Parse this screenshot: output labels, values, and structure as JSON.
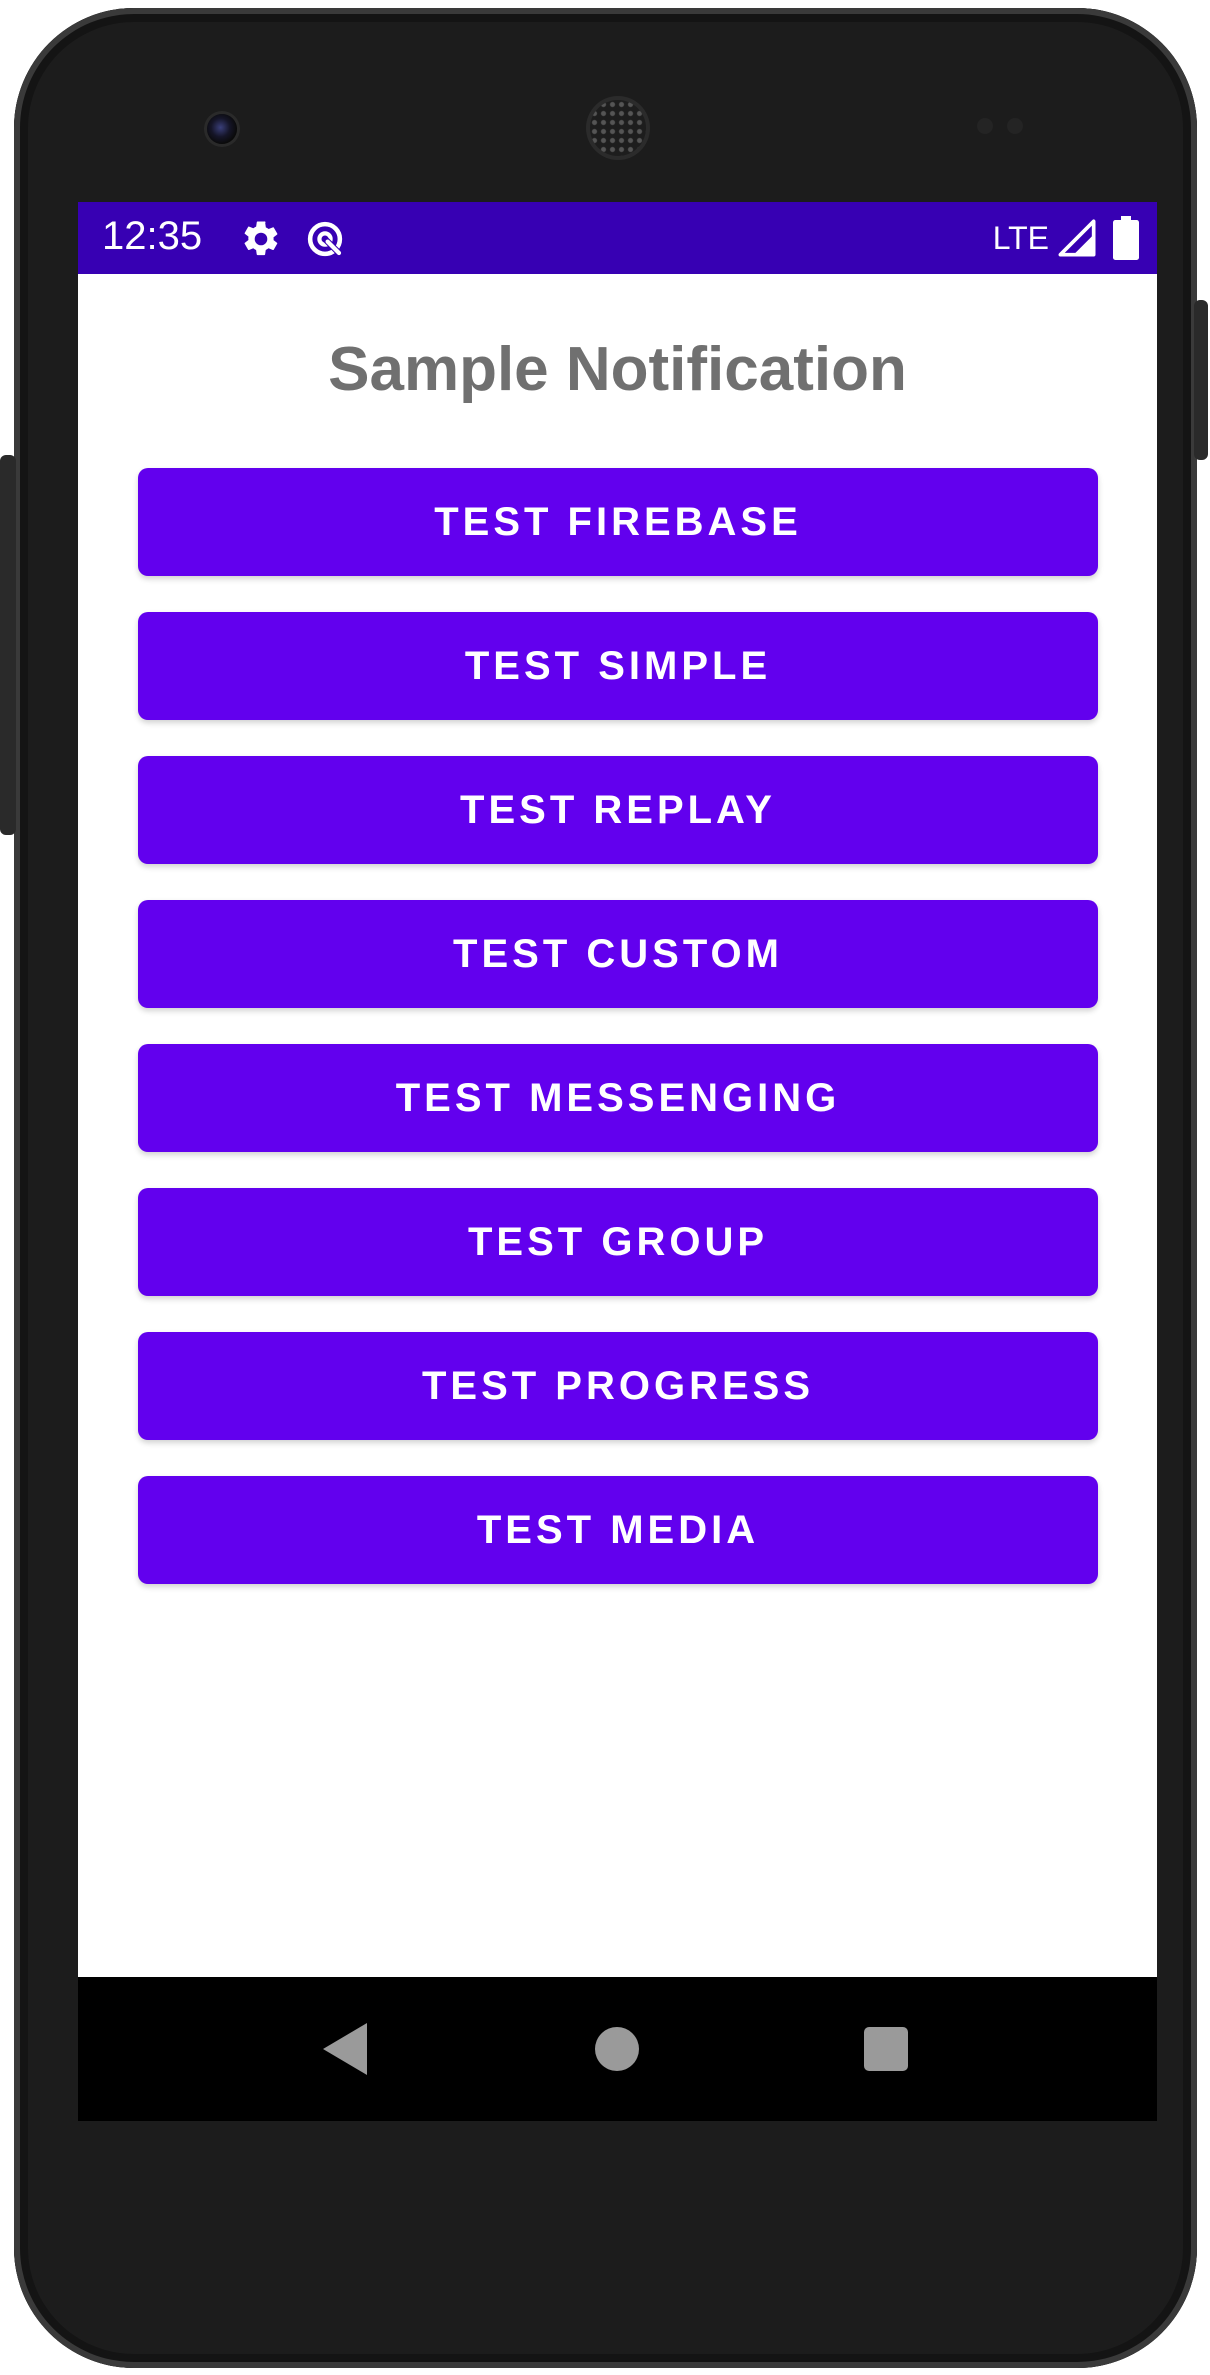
{
  "status_bar": {
    "time": "12:35",
    "icons": [
      "settings-icon",
      "data-saver-icon"
    ],
    "network": "LTE",
    "signal_icon": "signal-icon",
    "battery_icon": "battery-icon"
  },
  "app": {
    "title": "Sample Notification",
    "buttons": [
      "TEST FIREBASE",
      "TEST SIMPLE",
      "TEST REPLAY",
      "TEST CUSTOM",
      "TEST MESSENGING",
      "TEST GROUP",
      "TEST PROGRESS",
      "TEST MEDIA"
    ]
  },
  "nav_bar": {
    "icons": [
      "back-icon",
      "home-icon",
      "recent-apps-icon"
    ]
  },
  "colors": {
    "status_bar": "#3700b3",
    "button": "#6200ee",
    "title_text": "#707070",
    "background": "#ffffff"
  }
}
